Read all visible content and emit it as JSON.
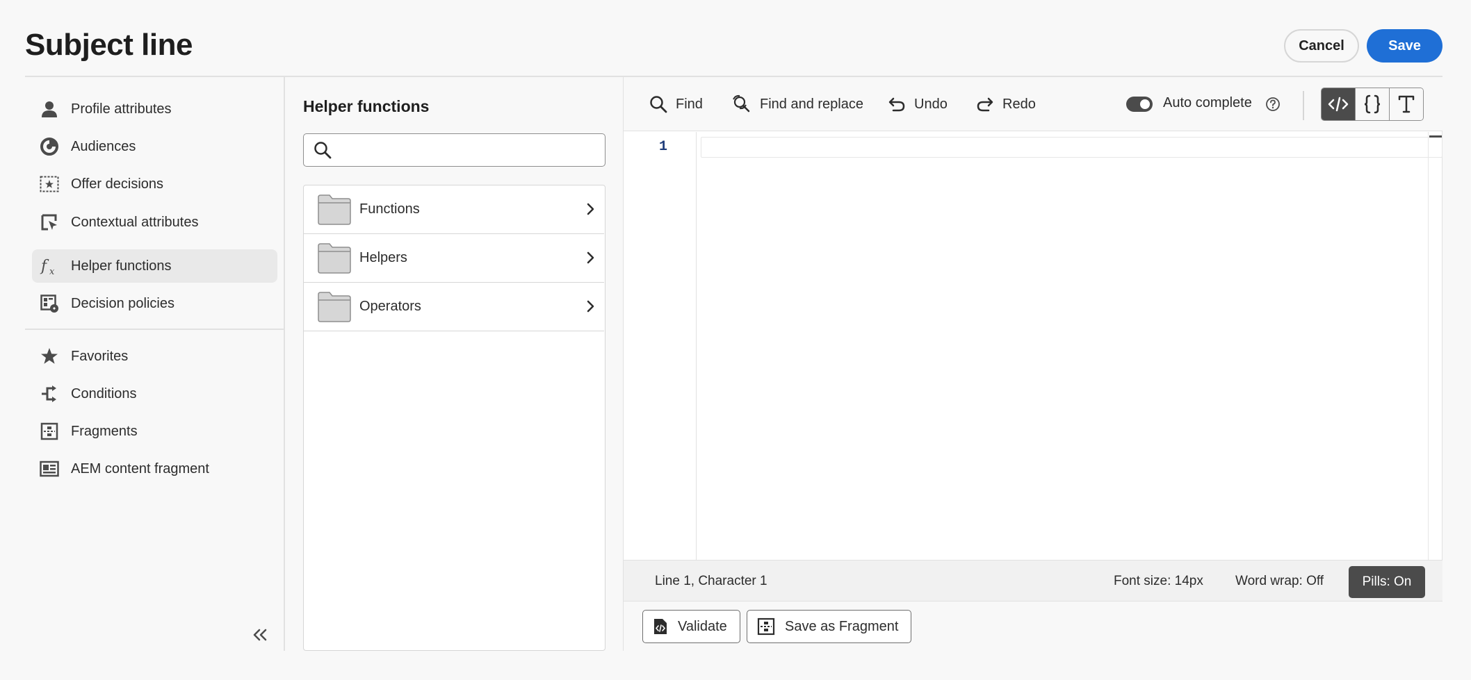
{
  "header": {
    "title": "Subject line",
    "cancel_label": "Cancel",
    "save_label": "Save"
  },
  "nav": {
    "items": [
      {
        "label": "Profile attributes",
        "icon": "user-icon"
      },
      {
        "label": "Audiences",
        "icon": "audience-icon"
      },
      {
        "label": "Offer decisions",
        "icon": "offer-icon"
      },
      {
        "label": "Contextual attributes",
        "icon": "contextual-icon"
      },
      {
        "label": "Helper functions",
        "icon": "function-icon",
        "active": true
      },
      {
        "label": "Decision policies",
        "icon": "decision-policy-icon"
      }
    ],
    "secondary_items": [
      {
        "label": "Favorites",
        "icon": "star-icon"
      },
      {
        "label": "Conditions",
        "icon": "conditions-icon"
      },
      {
        "label": "Fragments",
        "icon": "fragment-icon"
      },
      {
        "label": "AEM content fragment",
        "icon": "aem-fragment-icon"
      }
    ]
  },
  "helper": {
    "title": "Helper functions",
    "search_placeholder": "",
    "folders": [
      {
        "label": "Functions"
      },
      {
        "label": "Helpers"
      },
      {
        "label": "Operators"
      }
    ]
  },
  "toolbar": {
    "find_label": "Find",
    "find_replace_label": "Find and replace",
    "undo_label": "Undo",
    "redo_label": "Redo",
    "autocomplete_label": "Auto complete",
    "autocomplete_on": true
  },
  "editor": {
    "line_numbers": [
      "1"
    ],
    "content": ""
  },
  "status": {
    "position": "Line 1, Character 1",
    "font_size": "Font size: 14px",
    "word_wrap": "Word wrap: Off",
    "pills": "Pills: On"
  },
  "footer": {
    "validate_label": "Validate",
    "save_fragment_label": "Save as Fragment"
  },
  "colors": {
    "accent": "#1f6fd6",
    "dark": "#4b4b4b",
    "background": "#f8f8f8"
  }
}
